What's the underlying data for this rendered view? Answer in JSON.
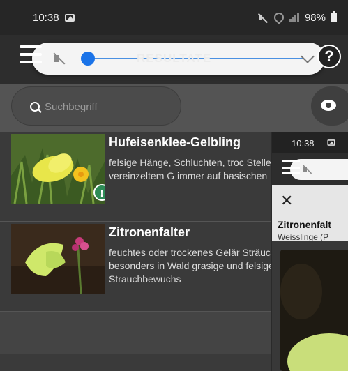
{
  "status_bar": {
    "time": "10:38",
    "battery": "98%"
  },
  "app_bar": {
    "title": "RESULTATE",
    "help_label": "?"
  },
  "search": {
    "placeholder": "Suchbegriff"
  },
  "results": [
    {
      "name": "Hufeisenklee-Gelbling",
      "description": "felsige Hänge, Schluchten, troc Stellen, oft mit vereinzeltem G immer auf basischen Böden",
      "badge": "!"
    },
    {
      "name": "Zitronenfalter",
      "description": "feuchtes oder trockenes Gelär Sträuchern, besonders in Wald grasige und felsige Hänge mit Strauchbewuchs"
    }
  ],
  "overlay": {
    "time": "10:38",
    "close_label": "✕",
    "title": "Zitronenfalt",
    "subtitle": "Weisslinge (P"
  },
  "colors": {
    "accent": "#1a73e8",
    "badge_green": "#2e8b57",
    "background": "#3a3a3a"
  }
}
